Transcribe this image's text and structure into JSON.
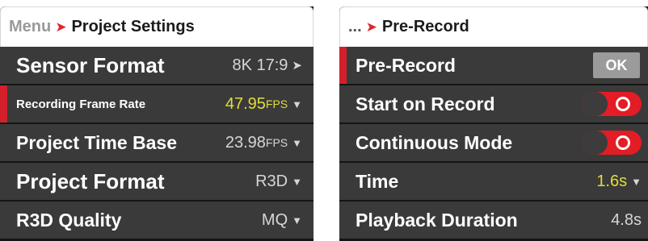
{
  "left_panel": {
    "breadcrumb_root": "Menu",
    "breadcrumb_separator": "➤",
    "title": "Project Settings",
    "rows": [
      {
        "label": "Sensor Format",
        "value": "8K 17:9",
        "control": "arrow-right"
      },
      {
        "label": "Recording Frame Rate",
        "value": "47.95",
        "unit": "FPS",
        "control": "chevron-down",
        "selected": true
      },
      {
        "label": "Project Time Base",
        "value": "23.98",
        "unit": "FPS",
        "control": "chevron-down"
      },
      {
        "label": "Project Format",
        "value": "R3D",
        "control": "chevron-down"
      },
      {
        "label": "R3D Quality",
        "value": "MQ",
        "control": "chevron-down"
      }
    ]
  },
  "right_panel": {
    "breadcrumb_root": "...",
    "breadcrumb_separator": "➤",
    "title": "Pre-Record",
    "rows": [
      {
        "label": "Pre-Record",
        "button": "OK",
        "selected": true
      },
      {
        "label": "Start on Record",
        "toggle": "on"
      },
      {
        "label": "Continuous Mode",
        "toggle": "on"
      },
      {
        "label": "Time",
        "value": "1.6s",
        "control": "chevron-down"
      },
      {
        "label": "Playback Duration",
        "value": "4.8s"
      }
    ]
  },
  "colors": {
    "accent_red": "#e31c25",
    "highlight_yellow": "#e2dd3a",
    "row_background": "#3a3a3a",
    "panel_background": "#151515"
  }
}
